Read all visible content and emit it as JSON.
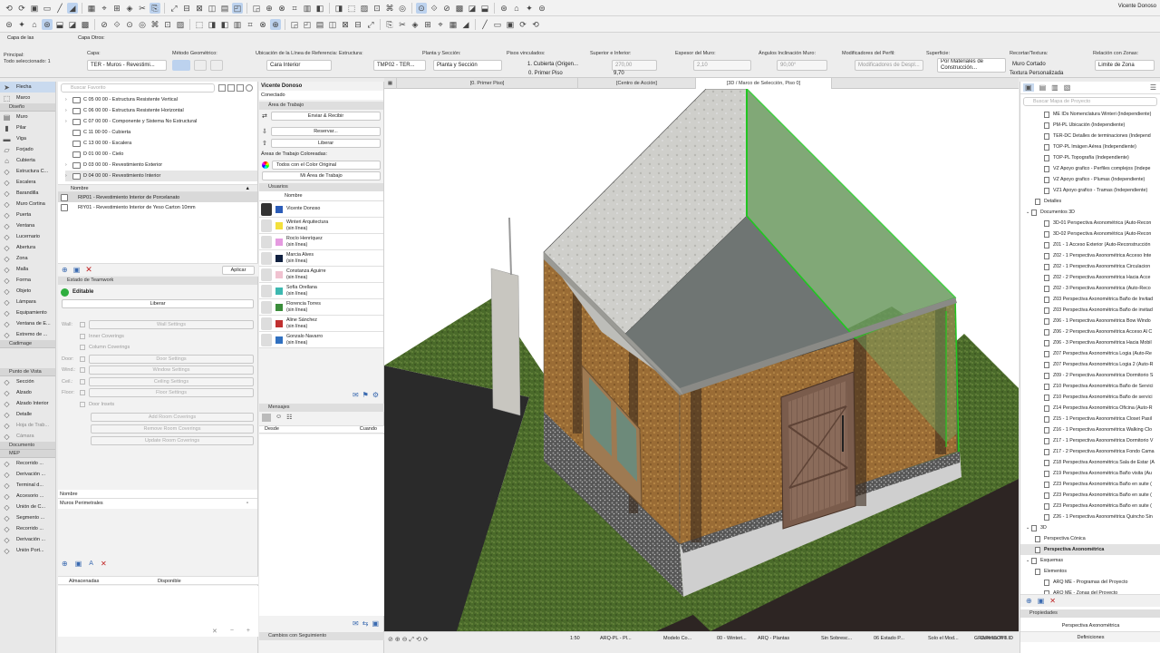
{
  "toolbar": {
    "vicente": "Vicente Donoso"
  },
  "infobar": {
    "capa_de_las": "Capa de las",
    "capa_otros": "Capa Otros:",
    "principal": "Principal:",
    "todo_sel": "Todo seleccionado: 1",
    "capa_lbl": "Capa:",
    "capa_val": "TER - Muros - Revestimi...",
    "metodo_lbl": "Método Geométrico:",
    "linea_lbl": "Ubicación de la Línea de Referencia:",
    "linea_val": "Cara Interior",
    "estructura_lbl": "Estructura:",
    "estructura_val": "TMP02 - TER...",
    "planta_lbl": "Planta y Sección:",
    "planta_val": "Planta y Sección",
    "pisos_lbl": "Pisos vinculados:",
    "pisos_v1": "1. Cubierta (Origen...",
    "pisos_v2": "0. Primer Piso",
    "sup_lbl": "Superior e Inferior:",
    "sup_v1": "270,00",
    "sup_v2": "9,70",
    "espesor_lbl": "Espesor del Muro:",
    "espesor_val": "2,10",
    "angulos_lbl": "Ángulos Inclinación Muro:",
    "angulos_val": "90,00°",
    "mod_lbl": "Modificadores del Perfil:",
    "mod_val": "Modificadores de Despl...",
    "superficie_lbl": "Superficie:",
    "superficie_val": "Por Materiales de Construcción...",
    "recortar_lbl": "Recortar/Textura:",
    "recortar_v1": "Muro Cortado",
    "recortar_v2": "Textura Personalizada",
    "relacion_lbl": "Relación con Zonas:",
    "relacion_val": "Limite de Zona"
  },
  "toolbox": {
    "sections": [
      "Diseño",
      "Cadimage",
      "Punto de Vista",
      "Documento",
      "MEP"
    ],
    "top": [
      "Flecha",
      "Marco"
    ],
    "diseno": [
      "Muro",
      "Pilar",
      "Viga",
      "Forjado",
      "Cubierta",
      "Estructura C...",
      "Escalera",
      "Barandilla",
      "Muro Cortina",
      "Puerta",
      "Ventana",
      "Lucernario",
      "Abertura",
      "Zona",
      "Malla",
      "Forma",
      "Objeto",
      "Lámpara",
      "Equipamiento",
      "Ventana de E...",
      "Extremo de ..."
    ],
    "punto": [
      "Sección",
      "Alzado",
      "Alzado Interior",
      "Detalle",
      "Hoja de Trab...",
      "Cámara"
    ],
    "mep": [
      "Recorrido ...",
      "Derivación ...",
      "Terminal d...",
      "Accesorio ...",
      "Unión de C...",
      "Segmento ...",
      "Recorrido ...",
      "Derivación ...",
      "Unión Port..."
    ]
  },
  "navigator": {
    "search": "Buscar Favorito",
    "items": [
      "C 05 00 00 - Estructura Resistente Vertical",
      "C 06 00 00 - Estructura Resistente Horizontal",
      "C 07 00 00 - Componente y Sistema No Estructural",
      "C 11 00 00 - Cubierta",
      "C 13 00 00 - Escalera",
      "D 01 00 00 - Cielo",
      "D 03 00 00 - Revestimiento Exterior",
      "D 04 00 00 - Revestimiento Interior"
    ],
    "col": "Nombre",
    "favs": [
      "RIP01 - Revestimiento Interior de Porcelanato",
      "RIY01 - Revestimiento Interior de Yeso Carton 10mm"
    ],
    "apply": "Aplicar"
  },
  "teamwork": {
    "title": "Estado de Teamwork",
    "editable": "Editable",
    "liberar": "Liberar",
    "rows": [
      [
        "Wall:",
        "Wall Settings"
      ],
      [
        "",
        "Inner Coverings"
      ],
      [
        "",
        "Column Coverings"
      ],
      [
        "Door:",
        "Door Settings"
      ],
      [
        "Wind.:",
        "Window Settings"
      ],
      [
        "Ceil.:",
        "Ceiling Settings"
      ],
      [
        "Floor:",
        "Floor Settings"
      ],
      [
        "",
        "Door Insets"
      ]
    ],
    "buttons": [
      "Add Room Coverings",
      "Remove Room Coverings",
      "Update Room Coverings"
    ],
    "nombre": "Nombre",
    "muros": "Muros Perimetrales",
    "almacenadas": "Almacenadas",
    "disponible": "Disponible"
  },
  "users": {
    "name": "Vicente Donoso",
    "conectado": "Conectado",
    "area": "Área de Trabajo",
    "enviar": "Enviar & Recibir",
    "reservar": "Reservar...",
    "liberar": "Liberar",
    "areas_col": "Áreas de Trabajo Coloreadas:",
    "todos": "Todos con el Color Original",
    "mi_area": "Mi Área de Trabajo",
    "usuarios": "Usuarios",
    "nombre": "Nombre",
    "list": [
      {
        "n": "Vicente Donoso",
        "s": "",
        "c": "#2b5cb8"
      },
      {
        "n": "Winteri Arquitectura",
        "s": "(sin línea)",
        "c": "#f3e03c"
      },
      {
        "n": "Rocío Henríquez",
        "s": "(sin línea)",
        "c": "#e59ae0"
      },
      {
        "n": "Marcia Alves",
        "s": "(sin línea)",
        "c": "#102040"
      },
      {
        "n": "Constanza Aguirre",
        "s": "(sin línea)",
        "c": "#f0c2d0"
      },
      {
        "n": "Sofía Orellana",
        "s": "(sin línea)",
        "c": "#3db8b0"
      },
      {
        "n": "Florencia Torres",
        "s": "(sin línea)",
        "c": "#3b8d3b"
      },
      {
        "n": "Aline Sánchez",
        "s": "(sin línea)",
        "c": "#c03030"
      },
      {
        "n": "Gonzalo Navarro",
        "s": "(sin línea)",
        "c": "#3070c0"
      }
    ],
    "mensajes": "Mensajes",
    "desde": "Desde",
    "cuando": "Cuando",
    "cambios": "Cambios con Seguimiento"
  },
  "tabs": [
    "[0. Primer Piso]",
    "[Centro de Acción]",
    "[3D / Marco de Selección, Piso 0]"
  ],
  "status": {
    "scale": "1:50",
    "items": [
      "ARQ-PL - Pl...",
      "Modelo Co...",
      "00 - Winteri...",
      "ARQ - Plantas",
      "Sin Sobresc...",
      "06 Estado P...",
      "Solo el Mod...",
      "Colores Pro..."
    ],
    "brand": "GRAPHISOFT ID"
  },
  "right": {
    "search": "Buscar Mapa de Proyecto",
    "items": [
      [
        "ME IDs Nomenclatura Winteri (Independiente)",
        2
      ],
      [
        "PM-PL Ubicación (Independiente)",
        2
      ],
      [
        "TER-DC Detalles de terminaciones (Independ",
        2
      ],
      [
        "TOP-PL Imágen Aérea (Independiente)",
        2
      ],
      [
        "TOP-PL Topografía (Independiente)",
        2
      ],
      [
        "VZ Apoyo grafico - Perfiles complejos (Indepe",
        2
      ],
      [
        "VZ Apoyo grafico - Plumas (Independiente)",
        2
      ],
      [
        "VZ1 Apoyo grafico - Tramas (Independiente)",
        2
      ],
      [
        "Detalles",
        1
      ],
      [
        "Documentos 3D",
        0
      ],
      [
        "3D-01 Perspectiva Axonométrica (Auto-Recon",
        2
      ],
      [
        "3D-02 Perspectiva Axonométrica (Auto-Recon",
        2
      ],
      [
        "Z01 - 1 Acceso Exterior (Auto-Reconstrucción",
        2
      ],
      [
        "Z02 - 1 Perspectiva Axonométrica Acceso Inte",
        2
      ],
      [
        "Z02 - 1 Perspectiva Axonométrica Circulacion",
        2
      ],
      [
        "Z02 - 2 Perspectiva Axonométrica Hacia Acce",
        2
      ],
      [
        "Z02 - 3 Perspectiva Axonométrica (Auto-Reco",
        2
      ],
      [
        "Z03 Perspectiva Axonométrica Baño de Invitad",
        2
      ],
      [
        "Z03 Perspectiva Axonométrica Baño de invitad",
        2
      ],
      [
        "Z06 - 1 Perspectiva Axonométrica Bow Windo",
        2
      ],
      [
        "Z06 - 2 Perspectiva Axonométrica Acceso Al C",
        2
      ],
      [
        "Z06 - 3 Perspectiva Axonométrica Hacia Mobil",
        2
      ],
      [
        "Z07 Perspectiva Axonométrica Logia (Auto-Re",
        2
      ],
      [
        "Z07 Perspectiva Axonométrica Logia 2 (Auto-R",
        2
      ],
      [
        "Z09 - 2 Perspectiva Axonométrica Dormitorio S",
        2
      ],
      [
        "Z10 Perspectiva Axonométrica Baño de Servici",
        2
      ],
      [
        "Z10 Perspectiva Axonométrica Baño de servici",
        2
      ],
      [
        "Z14 Perspectiva Axonométrica Oficina (Auto-R",
        2
      ],
      [
        "Z15 - 1 Perspectiva Axonométrica Closet Pasil",
        2
      ],
      [
        "Z16 - 1 Perspectiva Axonométrica Walking Clo",
        2
      ],
      [
        "Z17 - 1 Perspectiva Axonométrica Dormitorio V",
        2
      ],
      [
        "Z17 - 2 Perspectiva Axonométrica Fondo Cama",
        2
      ],
      [
        "Z18 Perspectiva Axonométrica Sala de Estar (A",
        2
      ],
      [
        "Z19 Perspectiva Axonométrica Baño visita (Au",
        2
      ],
      [
        "Z23 Perspectiva Axonométrica Baño en suite (",
        2
      ],
      [
        "Z23 Perspectiva Axonométrica Baño en suite (",
        2
      ],
      [
        "Z23 Perspectiva Axonométrica Baño en suite (",
        2
      ],
      [
        "Z26 - 1 Perspectiva Axonométrica Quincho Sin",
        2
      ],
      [
        "3D",
        0
      ],
      [
        "Perspectiva Cónica",
        1
      ],
      [
        "Perspectiva Axonométrica",
        1
      ],
      [
        "Esquemas",
        0
      ],
      [
        "Elementos",
        1
      ],
      [
        "ARQ ME - Programas del Proyecto",
        2
      ],
      [
        "ARQ ME - Zonas del Proyecto",
        2
      ]
    ],
    "propiedades": "Propiedades",
    "prop_val": "Perspectiva Axonométrica",
    "definiciones": "Definiciones"
  }
}
